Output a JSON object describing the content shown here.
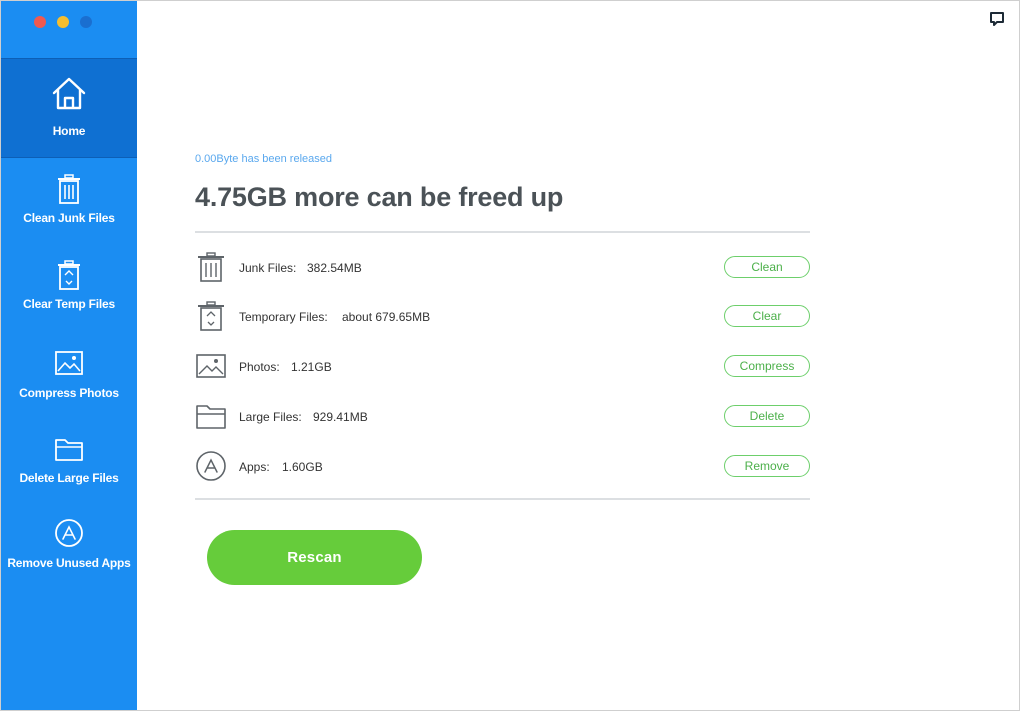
{
  "window": {
    "traffic_lights": {
      "close_color": "#f0594f",
      "minimize_color": "#f6be2f",
      "zoom_color": "#1a6fd0"
    }
  },
  "sidebar": {
    "background": "#1b8df2",
    "items": [
      {
        "label": "Home",
        "icon": "home-icon",
        "active": true
      },
      {
        "label": "Clean Junk Files",
        "icon": "trash-icon",
        "active": false
      },
      {
        "label": "Clear Temp Files",
        "icon": "temp-files-icon",
        "active": false
      },
      {
        "label": "Compress Photos",
        "icon": "photo-icon",
        "active": false
      },
      {
        "label": "Delete Large Files",
        "icon": "folder-icon",
        "active": false
      },
      {
        "label": "Remove Unused Apps",
        "icon": "app-store-icon",
        "active": false
      }
    ]
  },
  "header": {
    "chat_icon": "chat-icon"
  },
  "main": {
    "released_text": "0.00Byte has been released",
    "headline": "4.75GB more can be freed up",
    "rows": [
      {
        "label": "Junk Files:",
        "value": "382.54MB",
        "button": "Clean",
        "icon": "trash-icon"
      },
      {
        "label": "Temporary Files:",
        "value": "about 679.65MB",
        "button": "Clear",
        "icon": "temp-files-icon"
      },
      {
        "label": "Photos:",
        "value": "1.21GB",
        "button": "Compress",
        "icon": "photo-icon"
      },
      {
        "label": "Large Files:",
        "value": "929.41MB",
        "button": "Delete",
        "icon": "folder-icon"
      },
      {
        "label": "Apps:",
        "value": "1.60GB",
        "button": "Remove",
        "icon": "app-store-icon"
      }
    ],
    "rescan_label": "Rescan",
    "accent_green": "#66cc3b"
  }
}
